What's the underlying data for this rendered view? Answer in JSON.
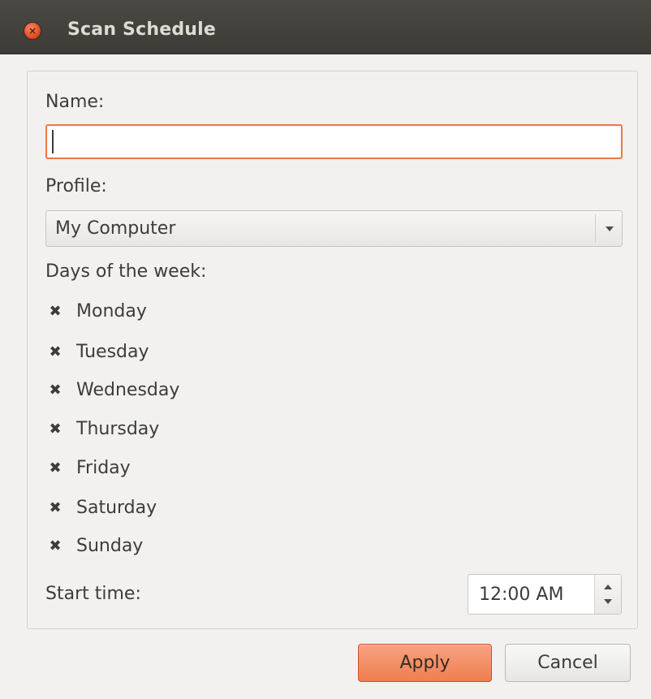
{
  "window": {
    "title": "Scan Schedule",
    "close_symbol": "×"
  },
  "form": {
    "name_label": "Name:",
    "name_value": "",
    "profile_label": "Profile:",
    "profile_value": "My Computer",
    "days_label": "Days of the week:",
    "days": [
      {
        "label": "Monday",
        "checked": true
      },
      {
        "label": "Tuesday",
        "checked": true
      },
      {
        "label": "Wednesday",
        "checked": true
      },
      {
        "label": "Thursday",
        "checked": true
      },
      {
        "label": "Friday",
        "checked": true
      },
      {
        "label": "Saturday",
        "checked": true
      },
      {
        "label": "Sunday",
        "checked": true
      }
    ],
    "check_mark": "✖",
    "start_time_label": "Start time:",
    "start_time_value": "12:00 AM"
  },
  "buttons": {
    "apply_label": "Apply",
    "cancel_label": "Cancel"
  },
  "colors": {
    "titlebar": "#3c3b37",
    "accent": "#ef7e50",
    "focus_border": "#f07746"
  },
  "icons": {
    "close": "close-icon",
    "check": "check-icon",
    "dropdown": "chevron-down-icon",
    "spin_up": "chevron-up-icon",
    "spin_down": "chevron-down-icon"
  }
}
